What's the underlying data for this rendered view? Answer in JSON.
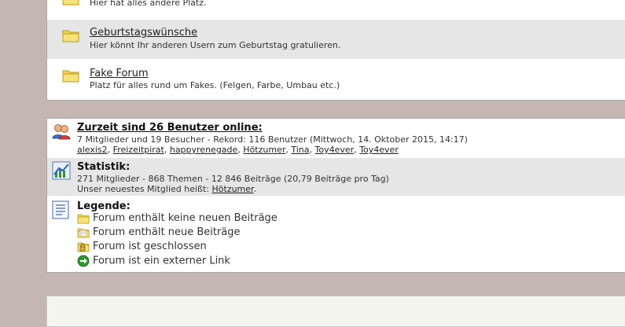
{
  "forums": [
    {
      "title": "",
      "description": "Hier hat alles andere Platz."
    },
    {
      "title": "Geburtstagswünsche",
      "description": "Hier könnt Ihr anderen Usern zum Geburtstag gratulieren."
    },
    {
      "title": "Fake Forum",
      "description": "Platz für alles rund um Fakes. (Felgen, Farbe, Umbau etc.)"
    }
  ],
  "online": {
    "heading": "Zurzeit sind 26 Benutzer online:",
    "summary": "7 Mitglieder und 19 Besucher - Rekord: 116 Benutzer (Mittwoch, 14. Oktober 2015, 14:17)",
    "users": [
      "alexis2",
      "Freizeitpirat",
      "happyrenegade",
      "Hötzumer",
      "Tina",
      "Toy4ever",
      "Toy4ever"
    ]
  },
  "statistics": {
    "heading": "Statistik:",
    "summary": "271 Mitglieder - 868 Themen - 12 846 Beiträge (20,79 Beiträge pro Tag)",
    "newest_prefix": "Unser neuestes Mitglied heißt: ",
    "newest_member": "Hötzumer",
    "newest_suffix": "."
  },
  "legend": {
    "heading": "Legende:",
    "items": [
      {
        "icon": "folder-icon",
        "label": "Forum enthält keine neuen Beiträge"
      },
      {
        "icon": "folder-new-icon",
        "label": "Forum enthält neue Beiträge"
      },
      {
        "icon": "folder-locked-icon",
        "label": "Forum ist geschlossen"
      },
      {
        "icon": "external-link-icon",
        "label": "Forum ist ein externer Link"
      }
    ]
  },
  "colors": {
    "page_background": "#c4b6b0",
    "alt_row": "#e6e6e6",
    "folder": "#f2d64b",
    "external_link": "#2e9a2e"
  }
}
